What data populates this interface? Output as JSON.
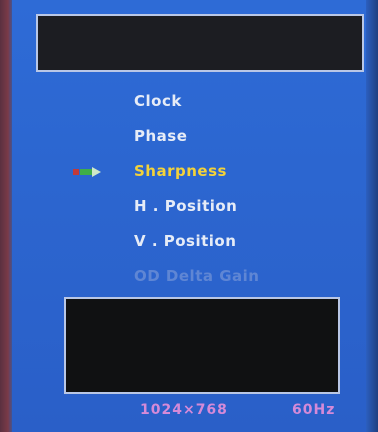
{
  "menu": {
    "items": [
      {
        "label": "Clock",
        "state": "normal"
      },
      {
        "label": "Phase",
        "state": "normal"
      },
      {
        "label": "Sharpness",
        "state": "selected"
      },
      {
        "label": "H . Position",
        "state": "normal"
      },
      {
        "label": "V . Position",
        "state": "normal"
      },
      {
        "label": "OD  Delta  Gain",
        "state": "disabled"
      }
    ],
    "selected_indicator_icon": "arrow-pointer-icon"
  },
  "status": {
    "resolution": "1024×768",
    "refresh_rate": "60Hz"
  },
  "colors": {
    "osd_background": "#2e6bd6",
    "menu_text": "#e6ecf7",
    "selected_text": "#f3d23a",
    "disabled_text": "#5f86d4",
    "status_text": "#d58ad8",
    "panel_border": "#b9c7e6"
  }
}
